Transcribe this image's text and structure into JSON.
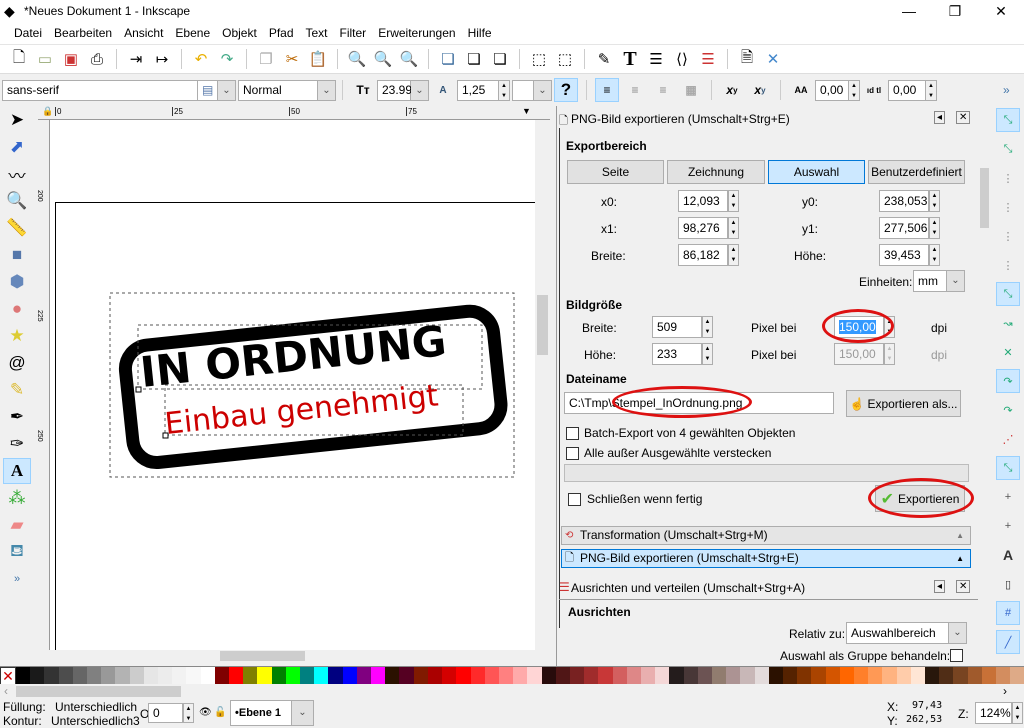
{
  "window": {
    "title": "*Neues Dokument 1 - Inkscape",
    "minimize": "—",
    "maximize": "❐",
    "close": "✕"
  },
  "menu": [
    {
      "label": "Datei"
    },
    {
      "label": "Bearbeiten"
    },
    {
      "label": "Ansicht"
    },
    {
      "label": "Ebene"
    },
    {
      "label": "Objekt"
    },
    {
      "label": "Pfad"
    },
    {
      "label": "Text"
    },
    {
      "label": "Filter"
    },
    {
      "label": "Erweiterungen"
    },
    {
      "label": "Hilfe"
    }
  ],
  "toolbar": {
    "icons": [
      "new-document-icon",
      "open-icon",
      "save-icon",
      "print-icon",
      "import-icon",
      "export-icon",
      "undo-icon",
      "redo-icon",
      "duplicate-icon",
      "cut-icon",
      "paste-icon",
      "zoom-selection-icon",
      "zoom-drawing-icon",
      "zoom-page-icon",
      "raise-icon",
      "lock-icon",
      "group-icon",
      "zoom-fit-selection-icon",
      "zoom-fit-lock-icon",
      "xml-editor-pen-icon",
      "text-font-icon",
      "layers-icon",
      "xml-editor-icon",
      "align-icon",
      "document-properties-icon",
      "preferences-icon"
    ]
  },
  "text_toolbar": {
    "font_family": "sans-serif",
    "font_style": "Normal",
    "font_size": "23.99",
    "line_spacing": "1,25",
    "help": "?",
    "letter_spacing": "0,00",
    "word_spacing": "0,00",
    "more": "»",
    "superscript": "x",
    "subscript": "x",
    "letter_label": "AA",
    "word_label": "ıd tl"
  },
  "ruler": {
    "ticks": [
      "0",
      "25",
      "50",
      "75"
    ],
    "left_ticks": [
      "200",
      "225",
      "250"
    ]
  },
  "canvas": {
    "line1": "IN ORDNUNG",
    "line2": "Einbau genehmigt",
    "line2_color": "#cc0000"
  },
  "dock": {
    "title": "PNG-Bild exportieren (Umschalt+Strg+E)",
    "exportbereich": "Exportbereich",
    "area_buttons": [
      {
        "label": "Seite"
      },
      {
        "label": "Zeichnung"
      },
      {
        "label": "Auswahl",
        "selected": true
      },
      {
        "label": "Benutzerdefiniert"
      }
    ],
    "x0_label": "x0:",
    "x0": "12,093",
    "y0_label": "y0:",
    "y0": "238,053",
    "x1_label": "x1:",
    "x1": "98,276",
    "y1_label": "y1:",
    "y1": "277,506",
    "breite_label": "Breite:",
    "breite": "86,182",
    "hoehe_label": "Höhe:",
    "hoehe": "39,453",
    "einheiten_label": "Einheiten:",
    "einheiten": "mm",
    "bildgroesse": "Bildgröße",
    "px_breite_label": "Breite:",
    "px_breite": "509",
    "pixel_bei": "Pixel bei",
    "dpi_x": "150,00",
    "dpi": "dpi",
    "px_hoehe_label": "Höhe:",
    "px_hoehe": "233",
    "dpi_y": "150,00",
    "dateiname": "Dateiname",
    "filename": "C:\\Tmp\\Stempel_InOrdnung.png",
    "export_as": "Exportieren als...",
    "batch": "Batch-Export von 4 gewählten Objekten",
    "hide": "Alle außer Ausgewählte verstecken",
    "close_when_done": "Schließen wenn fertig",
    "export": "Exportieren",
    "transformation": "Transformation (Umschalt+Strg+M)",
    "png_tab": "PNG-Bild exportieren (Umschalt+Strg+E)",
    "align_title": "Ausrichten und verteilen (Umschalt+Strg+A)",
    "ausrichten": "Ausrichten",
    "relativ_label": "Relativ zu:",
    "relativ": "Auswahlbereich",
    "group_label": "Auswahl als Gruppe behandeln:"
  },
  "palette": [
    "#000000",
    "#1a1a1a",
    "#333333",
    "#4d4d4d",
    "#666666",
    "#808080",
    "#999999",
    "#b3b3b3",
    "#cccccc",
    "#e6e6e6",
    "#ececec",
    "#f2f2f2",
    "#f8f8f8",
    "#ffffff",
    "#800000",
    "#ff0000",
    "#808000",
    "#ffff00",
    "#008000",
    "#00ff00",
    "#008080",
    "#00ffff",
    "#000080",
    "#0000ff",
    "#800080",
    "#ff00ff",
    "#2b1100",
    "#550022",
    "#801a00",
    "#aa0000",
    "#d40000",
    "#ff0000",
    "#ff2a2a",
    "#ff5555",
    "#ff8080",
    "#ffaaaa",
    "#ffd5d5",
    "#280b0b",
    "#501616",
    "#782121",
    "#a02c2c",
    "#c83737",
    "#d35f5f",
    "#de8787",
    "#e9afaf",
    "#f4d7d7",
    "#241c1c",
    "#483737",
    "#6c5353",
    "#917c6f",
    "#ac9393",
    "#c8b7b7",
    "#e3dbdb",
    "#2b1100",
    "#552200",
    "#803300",
    "#aa4400",
    "#d45500",
    "#ff6600",
    "#ff7f2a",
    "#ff9955",
    "#ffb380",
    "#ffccaa",
    "#ffe6d5",
    "#28170b",
    "#502d16",
    "#784421",
    "#a05a2c",
    "#c87137",
    "#d38d5f",
    "#deaa87"
  ],
  "status": {
    "fill_label": "Füllung:",
    "fill": "Unterschiedlich",
    "stroke_label": "Kontur:",
    "stroke": "Unterschiedlich",
    "stroke_width": "3",
    "opacity_label": "O:",
    "opacity": "0",
    "layer": "•Ebene 1",
    "x_label": "X:",
    "x": "97,43",
    "y_label": "Y:",
    "y": "262,53",
    "zoom_label": "Z:",
    "zoom": "124%"
  }
}
